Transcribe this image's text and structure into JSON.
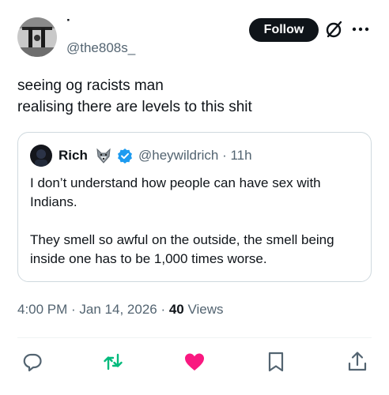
{
  "author": {
    "display_name": "·",
    "handle": "@the808s_"
  },
  "header": {
    "follow_label": "Follow",
    "grok_icon": "grok-slash-circle-icon",
    "more_icon": "more-horizontal-icon"
  },
  "tweet": {
    "text": "seeing og racists man\nrealising there are levels to this shit"
  },
  "quote": {
    "author_name": "Rich",
    "emoji_icon": "wolf-face-icon",
    "verified_icon": "verified-badge-icon",
    "handle_time": "@heywildrich · 11h",
    "paragraphs": [
      "I don’t understand how people can have sex with Indians.",
      "They smell so awful on the outside, the smell being inside one has to be 1,000 times worse."
    ]
  },
  "meta": {
    "timestamp": "4:00 PM · Jan 14, 2026 · ",
    "views_count": "40",
    "views_label": " Views"
  },
  "actions": [
    {
      "icon": "reply-icon",
      "color": "#536471"
    },
    {
      "icon": "retweet-icon",
      "color": "#00ba7c"
    },
    {
      "icon": "like-heart-icon",
      "color": "#f91880"
    },
    {
      "icon": "bookmark-icon",
      "color": "#536471"
    },
    {
      "icon": "share-icon",
      "color": "#536471"
    }
  ]
}
